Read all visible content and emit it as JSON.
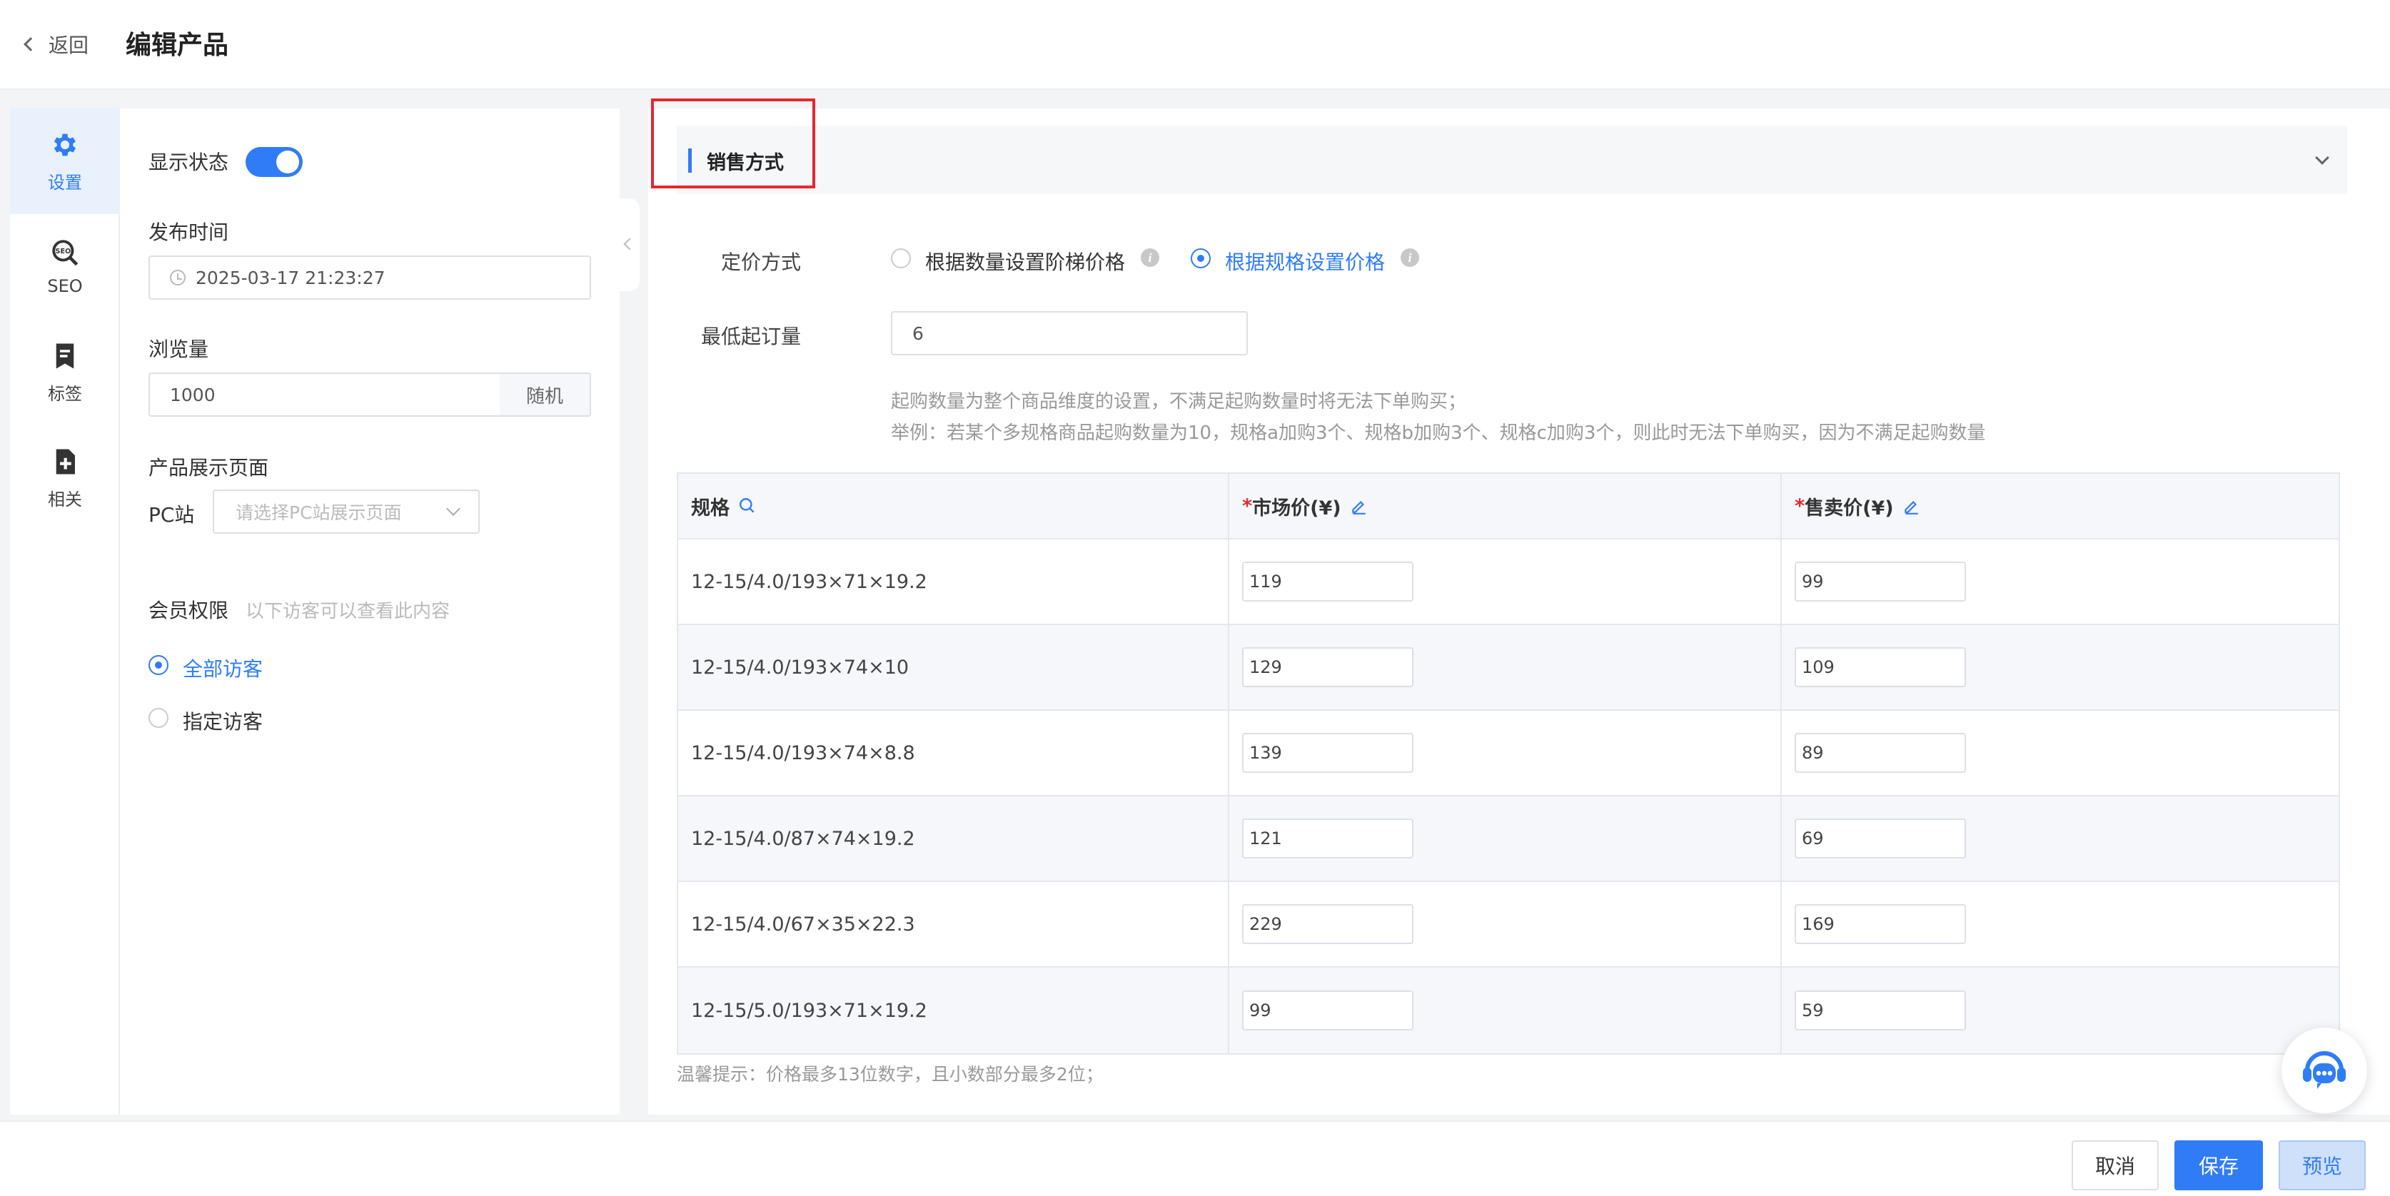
{
  "header": {
    "back_label": "返回",
    "title": "编辑产品"
  },
  "rail": {
    "items": [
      {
        "label": "设置",
        "icon": "gear-icon"
      },
      {
        "label": "SEO",
        "icon": "seo-icon"
      },
      {
        "label": "标签",
        "icon": "bookmark-icon"
      },
      {
        "label": "相关",
        "icon": "add-document-icon"
      }
    ]
  },
  "settings": {
    "display_status_label": "显示状态",
    "display_status_on": true,
    "publish_time_label": "发布时间",
    "publish_time_value": "2025-03-17 21:23:27",
    "views_label": "浏览量",
    "views_value": "1000",
    "random_button": "随机",
    "product_page_label": "产品展示页面",
    "pc_site_label": "PC站",
    "pc_site_placeholder": "请选择PC站展示页面",
    "member_label": "会员权限",
    "member_hint": "以下访客可以查看此内容",
    "visitor_options": [
      {
        "label": "全部访客",
        "selected": true
      },
      {
        "label": "指定访客",
        "selected": false
      }
    ]
  },
  "main": {
    "section_title": "销售方式",
    "pricing_label": "定价方式",
    "pricing_options": [
      {
        "label": "根据数量设置阶梯价格",
        "selected": false
      },
      {
        "label": "根据规格设置价格",
        "selected": true
      }
    ],
    "min_order_label": "最低起订量",
    "min_order_value": "6",
    "hint_line1": "起购数量为整个商品维度的设置，不满足起购数量时将无法下单购买；",
    "hint_line2": "举例：若某个多规格商品起购数量为10，规格a加购3个、规格b加购3个、规格c加购3个，则此时无法下单购买，因为不满足起购数量",
    "table": {
      "headers": {
        "spec": "规格",
        "market_price_req": "*",
        "market_price": "市场价(¥)",
        "sale_price_req": "*",
        "sale_price": "售卖价(¥)"
      },
      "rows": [
        {
          "spec": "12-15/4.0/193×71×19.2",
          "market": "119",
          "sale": "99"
        },
        {
          "spec": "12-15/4.0/193×74×10",
          "market": "129",
          "sale": "109"
        },
        {
          "spec": "12-15/4.0/193×74×8.8",
          "market": "139",
          "sale": "89"
        },
        {
          "spec": "12-15/4.0/87×74×19.2",
          "market": "121",
          "sale": "69"
        },
        {
          "spec": "12-15/4.0/67×35×22.3",
          "market": "229",
          "sale": "169"
        },
        {
          "spec": "12-15/5.0/193×71×19.2",
          "market": "99",
          "sale": "59"
        }
      ]
    },
    "tip": "温馨提示：价格最多13位数字，且小数部分最多2位；"
  },
  "footer": {
    "cancel": "取消",
    "save": "保存",
    "preview": "预览"
  },
  "colors": {
    "accent": "#2f7cf6",
    "highlight_box": "#e8262b"
  }
}
